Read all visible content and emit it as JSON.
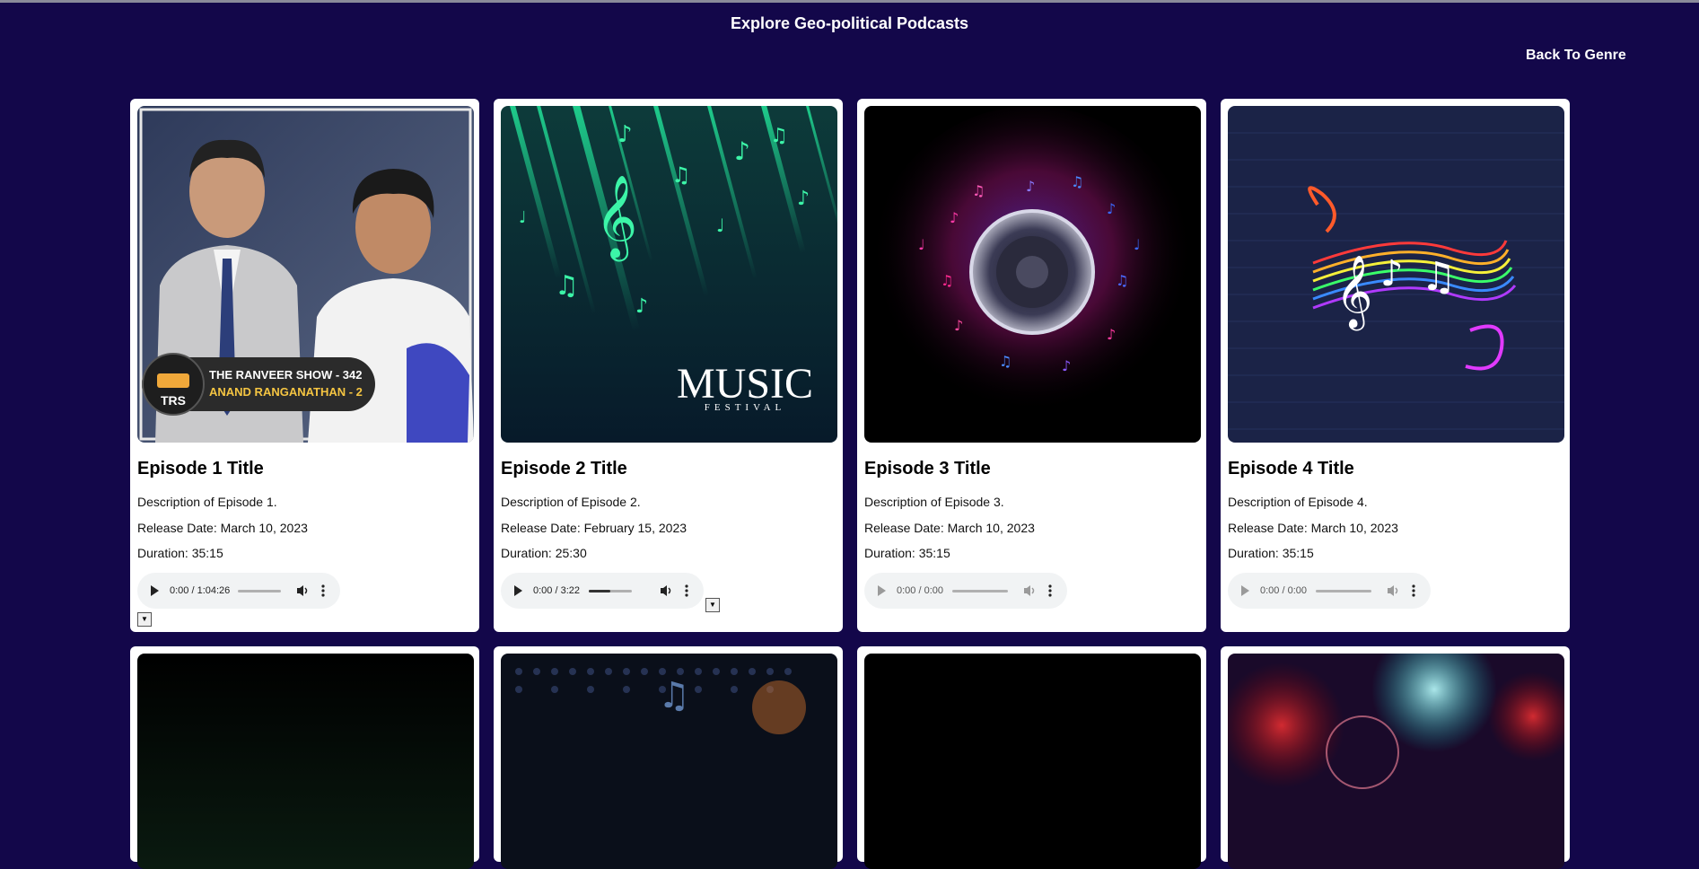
{
  "page": {
    "title": "Explore Geo-political Podcasts",
    "back_link": "Back To Genre"
  },
  "episodes": [
    {
      "title": "Episode 1 Title",
      "description": "Description of Episode 1.",
      "release": "Release Date: March 10, 2023",
      "duration": "Duration: 35:15",
      "player_time": "0:00 / 1:04:26",
      "progress": 0,
      "thumb_text": [
        "THE RANVEER SHOW - 342",
        "ANAND RANGANATHAN - 2",
        "TRS"
      ]
    },
    {
      "title": "Episode 2 Title",
      "description": "Description of Episode 2.",
      "release": "Release Date: February 15, 2023",
      "duration": "Duration: 25:30",
      "player_time": "0:00 / 3:22",
      "progress": 0.5,
      "thumb_text": [
        "MUSIC",
        "FESTIVAL"
      ]
    },
    {
      "title": "Episode 3 Title",
      "description": "Description of Episode 3.",
      "release": "Release Date: March 10, 2023",
      "duration": "Duration: 35:15",
      "player_time": "0:00 / 0:00",
      "progress": 0
    },
    {
      "title": "Episode 4 Title",
      "description": "Description of Episode 4.",
      "release": "Release Date: March 10, 2023",
      "duration": "Duration: 35:15",
      "player_time": "0:00 / 0:00",
      "progress": 0
    }
  ],
  "icons": {
    "play": "play-icon",
    "volume": "volume-icon",
    "more": "more-options-icon",
    "expand": "expand-toggle-icon"
  },
  "expand_symbol": "▼",
  "colors": {
    "background": "#13074a",
    "card": "#ffffff",
    "player": "#f1f3f4"
  }
}
